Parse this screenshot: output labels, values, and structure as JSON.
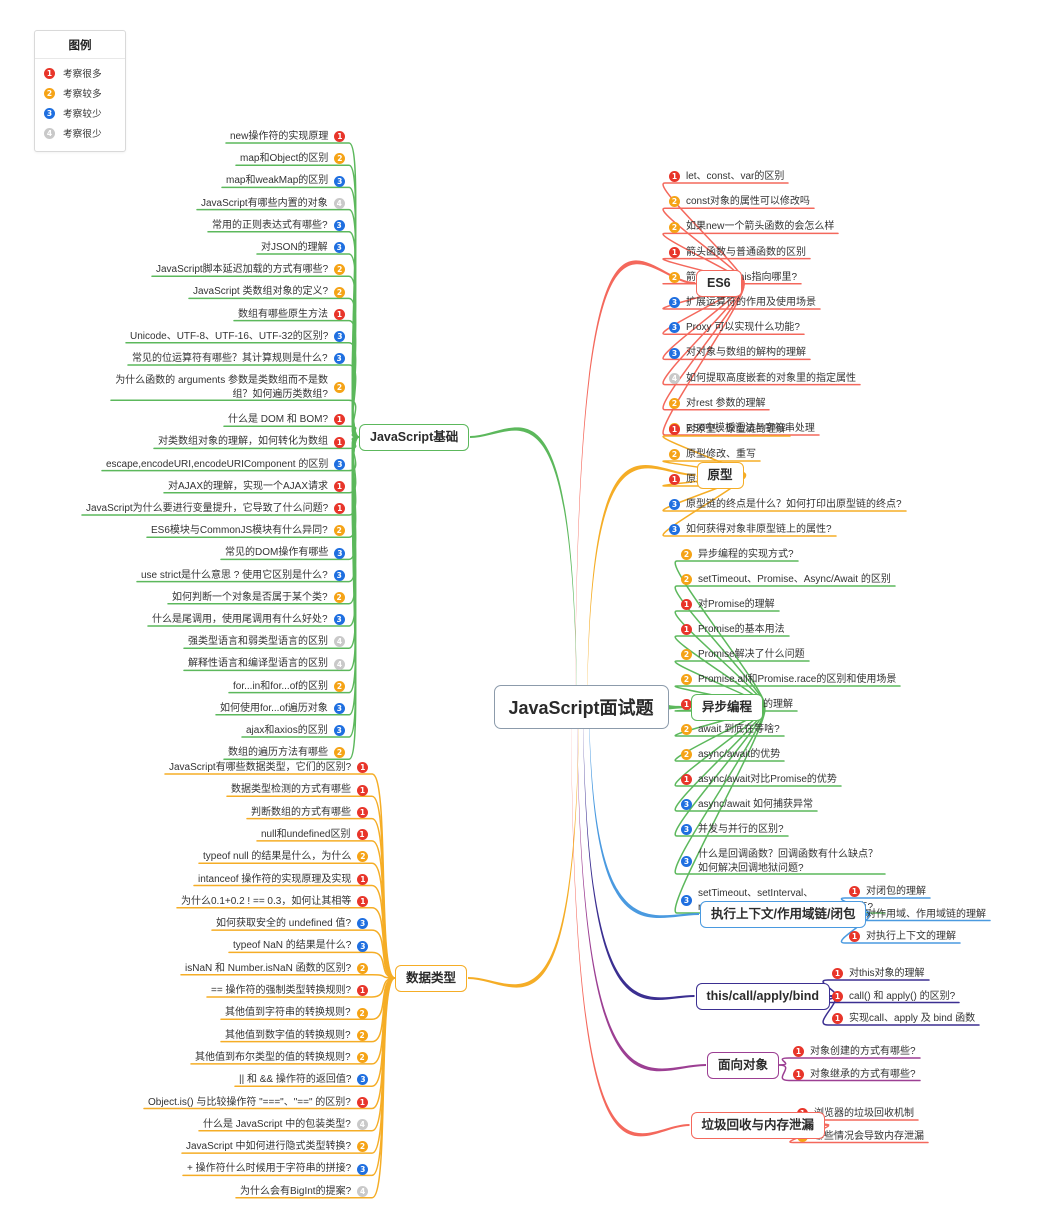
{
  "legend": {
    "title": "图例",
    "items": [
      {
        "n": "1",
        "label": "考察很多",
        "color": "#e8352a"
      },
      {
        "n": "2",
        "label": "考察较多",
        "color": "#f5a316"
      },
      {
        "n": "3",
        "label": "考察较少",
        "color": "#1f6fe0"
      },
      {
        "n": "4",
        "label": "考察很少",
        "color": "#c9c9c9"
      }
    ]
  },
  "center": {
    "label": "JavaScript面试题",
    "border": "#8c9bab"
  },
  "branches": [
    {
      "id": "es6",
      "label": "ES6",
      "color": "#f4685c",
      "side": "right",
      "children": [
        {
          "n": "1",
          "text": "let、const、var的区别"
        },
        {
          "n": "2",
          "text": "const对象的属性可以修改吗"
        },
        {
          "n": "2",
          "text": "如果new一个箭头函数的会怎么样"
        },
        {
          "n": "1",
          "text": "箭头函数与普通函数的区别"
        },
        {
          "n": "2",
          "text": "箭头函数的this指向哪里?"
        },
        {
          "n": "3",
          "text": "扩展运算符的作用及使用场景"
        },
        {
          "n": "3",
          "text": "Proxy 可以实现什么功能?"
        },
        {
          "n": "3",
          "text": "对对象与数组的解构的理解"
        },
        {
          "n": "4",
          "text": "如何提取高度嵌套的对象里的指定属性"
        },
        {
          "n": "2",
          "text": "对rest 参数的理解"
        },
        {
          "n": "2",
          "text": "ES6中模板语法与字符串处理"
        }
      ]
    },
    {
      "id": "prototype",
      "label": "原型",
      "color": "#f5ad26",
      "side": "right",
      "children": [
        {
          "n": "1",
          "text": "对原型、原型链的理解"
        },
        {
          "n": "2",
          "text": "原型修改、重写"
        },
        {
          "n": "1",
          "text": "原型链指向"
        },
        {
          "n": "3",
          "text": "原型链的终点是什么？如何打印出原型链的终点?"
        },
        {
          "n": "3",
          "text": "如何获得对象非原型链上的属性?"
        }
      ]
    },
    {
      "id": "async",
      "label": "异步编程",
      "color": "#5cb85c",
      "side": "right",
      "children": [
        {
          "n": "2",
          "text": "异步编程的实现方式?"
        },
        {
          "n": "2",
          "text": "setTimeout、Promise、Async/Await 的区别"
        },
        {
          "n": "1",
          "text": "对Promise的理解"
        },
        {
          "n": "1",
          "text": "Promise的基本用法"
        },
        {
          "n": "2",
          "text": "Promise解决了什么问题"
        },
        {
          "n": "2",
          "text": "Promise.all和Promise.race的区别和使用场景"
        },
        {
          "n": "1",
          "text": "对async/await 的理解"
        },
        {
          "n": "2",
          "text": "await 到底在等啥?"
        },
        {
          "n": "2",
          "text": "async/await的优势"
        },
        {
          "n": "1",
          "text": "async/await对比Promise的优势"
        },
        {
          "n": "3",
          "text": "async/await 如何捕获异常"
        },
        {
          "n": "3",
          "text": "并发与并行的区别?"
        },
        {
          "n": "3",
          "text": "什么是回调函数？回调函数有什么缺点？如何解决回调地狱问题?",
          "lines": 2
        },
        {
          "n": "3",
          "text": "setTimeout、setInterval、requestAnimationFrame 各有什么特点?",
          "lines": 2
        }
      ]
    },
    {
      "id": "context",
      "label": "执行上下文/作用域链/闭包",
      "color": "#4a9ae0",
      "side": "right",
      "children": [
        {
          "n": "1",
          "text": "对闭包的理解"
        },
        {
          "n": "1",
          "text": "对作用域、作用域链的理解"
        },
        {
          "n": "1",
          "text": "对执行上下文的理解"
        }
      ]
    },
    {
      "id": "this",
      "label": "this/call/apply/bind",
      "color": "#3b2f91",
      "side": "right",
      "children": [
        {
          "n": "1",
          "text": "对this对象的理解"
        },
        {
          "n": "1",
          "text": "call() 和 apply() 的区别?"
        },
        {
          "n": "1",
          "text": "实现call、apply 及 bind 函数"
        }
      ]
    },
    {
      "id": "oop",
      "label": "面向对象",
      "color": "#9c3f93",
      "side": "right",
      "children": [
        {
          "n": "1",
          "text": "对象创建的方式有哪些?"
        },
        {
          "n": "1",
          "text": "对象继承的方式有哪些?"
        }
      ]
    },
    {
      "id": "gc",
      "label": "垃圾回收与内存泄漏",
      "color": "#f4685c",
      "side": "right",
      "children": [
        {
          "n": "1",
          "text": "浏览器的垃圾回收机制"
        },
        {
          "n": "2",
          "text": "哪些情况会导致内存泄漏"
        }
      ]
    },
    {
      "id": "basics",
      "label": "JavaScript基础",
      "color": "#5cb85c",
      "side": "left",
      "children": [
        {
          "n": "1",
          "text": "new操作符的实现原理"
        },
        {
          "n": "2",
          "text": "map和Object的区别"
        },
        {
          "n": "3",
          "text": "map和weakMap的区别"
        },
        {
          "n": "4",
          "text": "JavaScript有哪些内置的对象"
        },
        {
          "n": "3",
          "text": "常用的正则表达式有哪些?"
        },
        {
          "n": "3",
          "text": "对JSON的理解"
        },
        {
          "n": "2",
          "text": "JavaScript脚本延迟加载的方式有哪些?"
        },
        {
          "n": "2",
          "text": "JavaScript 类数组对象的定义?"
        },
        {
          "n": "1",
          "text": "数组有哪些原生方法"
        },
        {
          "n": "3",
          "text": "Unicode、UTF-8、UTF-16、UTF-32的区别?"
        },
        {
          "n": "3",
          "text": "常见的位运算符有哪些？其计算规则是什么?"
        },
        {
          "n": "2",
          "text": "为什么函数的 arguments 参数是类数组而不是数组？如何遍历类数组?",
          "lines": 2
        },
        {
          "n": "1",
          "text": "什么是 DOM 和 BOM?"
        },
        {
          "n": "1",
          "text": "对类数组对象的理解，如何转化为数组"
        },
        {
          "n": "3",
          "text": "escape,encodeURI,encodeURIComponent 的区别"
        },
        {
          "n": "1",
          "text": "对AJAX的理解，实现一个AJAX请求"
        },
        {
          "n": "1",
          "text": "JavaScript为什么要进行变量提升，它导致了什么问题?"
        },
        {
          "n": "2",
          "text": "ES6模块与CommonJS模块有什么异同?"
        },
        {
          "n": "3",
          "text": "常见的DOM操作有哪些"
        },
        {
          "n": "3",
          "text": "use strict是什么意思 ? 使用它区别是什么?"
        },
        {
          "n": "2",
          "text": "如何判断一个对象是否属于某个类?"
        },
        {
          "n": "3",
          "text": "什么是尾调用，使用尾调用有什么好处?"
        },
        {
          "n": "4",
          "text": "强类型语言和弱类型语言的区别"
        },
        {
          "n": "4",
          "text": "解释性语言和编译型语言的区别"
        },
        {
          "n": "2",
          "text": "for...in和for...of的区别"
        },
        {
          "n": "3",
          "text": "如何使用for...of遍历对象"
        },
        {
          "n": "3",
          "text": "ajax和axios的区别"
        },
        {
          "n": "2",
          "text": "数组的遍历方法有哪些"
        }
      ]
    },
    {
      "id": "datatype",
      "label": "数据类型",
      "color": "#f5ad26",
      "side": "left",
      "children": [
        {
          "n": "1",
          "text": "JavaScript有哪些数据类型，它们的区别?"
        },
        {
          "n": "1",
          "text": "数据类型检测的方式有哪些"
        },
        {
          "n": "1",
          "text": "判断数组的方式有哪些"
        },
        {
          "n": "1",
          "text": "null和undefined区别"
        },
        {
          "n": "2",
          "text": "typeof null 的结果是什么，为什么"
        },
        {
          "n": "1",
          "text": "intanceof 操作符的实现原理及实现"
        },
        {
          "n": "1",
          "text": "为什么0.1+0.2 ! == 0.3，如何让其相等"
        },
        {
          "n": "3",
          "text": "如何获取安全的 undefined 值?"
        },
        {
          "n": "3",
          "text": "typeof NaN 的结果是什么?"
        },
        {
          "n": "2",
          "text": "isNaN 和 Number.isNaN 函数的区别?"
        },
        {
          "n": "1",
          "text": "== 操作符的强制类型转换规则?"
        },
        {
          "n": "2",
          "text": "其他值到字符串的转换规则?"
        },
        {
          "n": "2",
          "text": "其他值到数字值的转换规则?"
        },
        {
          "n": "2",
          "text": "其他值到布尔类型的值的转换规则?"
        },
        {
          "n": "3",
          "text": "|| 和 && 操作符的返回值?"
        },
        {
          "n": "1",
          "text": "Object.is() 与比较操作符 \"===\"、\"==\" 的区别?"
        },
        {
          "n": "4",
          "text": "什么是 JavaScript 中的包装类型?"
        },
        {
          "n": "2",
          "text": "JavaScript 中如何进行隐式类型转换?"
        },
        {
          "n": "3",
          "text": "+ 操作符什么时候用于字符串的拼接?"
        },
        {
          "n": "4",
          "text": "为什么会有BigInt的提案?"
        }
      ]
    }
  ]
}
